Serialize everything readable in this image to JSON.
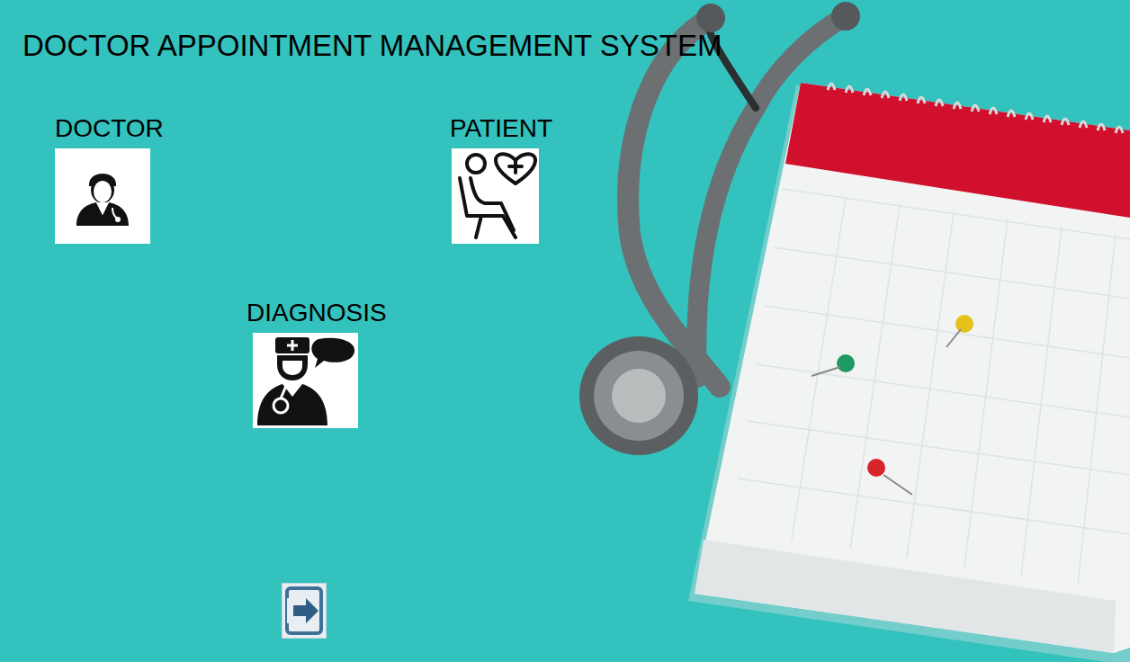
{
  "window": {
    "title": "DOCTOR APPOINTMENT MANAGEMENT SYSTEM"
  },
  "modules": [
    {
      "label": "DOCTOR"
    },
    {
      "label": "PATIENT"
    },
    {
      "label": "DIAGNOSIS"
    }
  ]
}
